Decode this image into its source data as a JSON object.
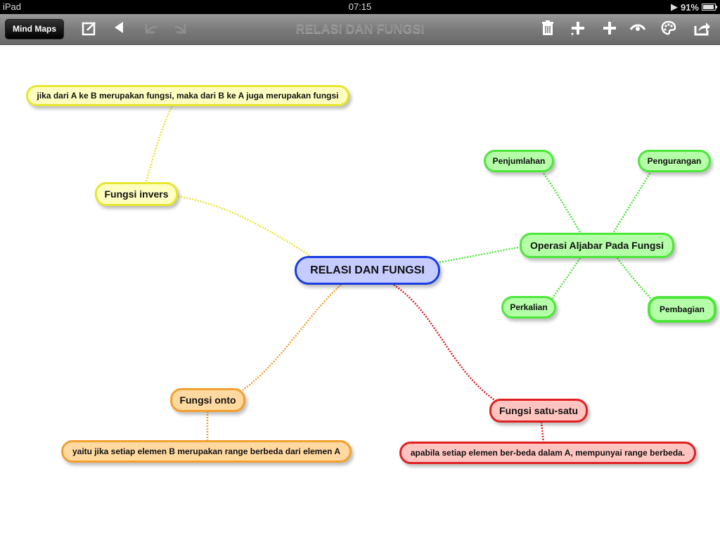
{
  "status_bar": {
    "device": "iPad",
    "time": "07:15",
    "battery_percent": "91%",
    "battery_level": 0.91,
    "play_icon": "play-icon"
  },
  "toolbar": {
    "back_label": "Mind Maps",
    "title": "RELASI DAN FUNGSI",
    "icons": {
      "edit": "edit-icon",
      "back": "back-arrow-icon",
      "undo": "undo-icon",
      "redo": "redo-icon",
      "delete": "trash-icon",
      "add_child": "add-child-icon",
      "add": "add-icon",
      "link": "link-icon",
      "palette": "palette-icon",
      "share": "share-icon"
    }
  },
  "mindmap": {
    "colors": {
      "yellow": "#e6e630",
      "green": "#4ee63a",
      "orange": "#f2a030",
      "red": "#e02020",
      "blue": "#1a3ee0"
    },
    "central": {
      "label": "RELASI DAN FUNGSI"
    },
    "nodes": {
      "fungsi_invers": "Fungsi invers",
      "fungsi_invers_note": "jika dari A ke B merupakan fungsi, maka dari B ke A juga merupakan fungsi",
      "operasi": "Operasi Aljabar Pada Fungsi",
      "penjumlahan": "Penjumlahan",
      "pengurangan": "Pengurangan",
      "perkalian": "Perkalian",
      "pembagian": "Pembagian",
      "fungsi_onto": "Fungsi onto",
      "fungsi_onto_note": "yaitu jika setiap elemen  B merupakan range berbeda dari elemen A",
      "fungsi_satu": "Fungsi satu-satu",
      "fungsi_satu_note": "apabila setiap elemen ber-beda dalam A, mempunyai range berbeda."
    }
  }
}
